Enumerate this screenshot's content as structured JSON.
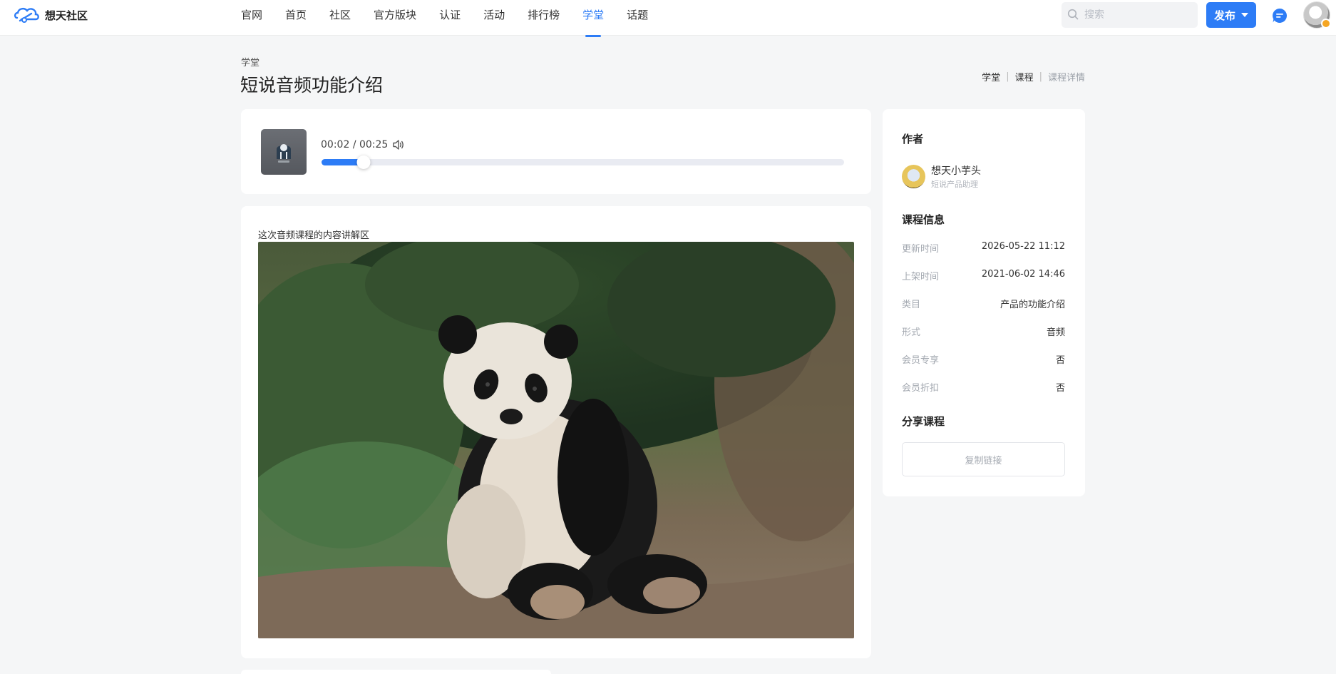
{
  "header": {
    "brand": "想天社区",
    "nav": [
      {
        "label": "官网",
        "active": false
      },
      {
        "label": "首页",
        "active": false
      },
      {
        "label": "社区",
        "active": false
      },
      {
        "label": "官方版块",
        "active": false
      },
      {
        "label": "认证",
        "active": false
      },
      {
        "label": "活动",
        "active": false
      },
      {
        "label": "排行榜",
        "active": false
      },
      {
        "label": "学堂",
        "active": true
      },
      {
        "label": "话题",
        "active": false
      }
    ],
    "search_placeholder": "搜索",
    "publish_label": "发布"
  },
  "page": {
    "section": "学堂",
    "title": "短说音频功能介绍",
    "breadcrumb": [
      "学堂",
      "课程",
      "课程详情"
    ]
  },
  "player": {
    "current_time": "00:02",
    "separator": "/",
    "duration": "00:25",
    "progress": 0.08
  },
  "content": {
    "intro": "这次音频课程的内容讲解区"
  },
  "sidebar": {
    "author_heading": "作者",
    "author_name": "想天小芋头",
    "author_role": "短说产品助理",
    "info_heading": "课程信息",
    "info": [
      {
        "key": "更新时间",
        "value": "2026-05-22 11:12"
      },
      {
        "key": "上架时间",
        "value": "2021-06-02 14:46"
      },
      {
        "key": "类目",
        "value": "产品的功能介绍"
      },
      {
        "key": "形式",
        "value": "音频"
      },
      {
        "key": "会员专享",
        "value": "否"
      },
      {
        "key": "会员折扣",
        "value": "否"
      }
    ],
    "share_heading": "分享课程",
    "copy_label": "复制链接"
  },
  "colors": {
    "accent": "#2d7cf6",
    "background": "#f5f6f7"
  }
}
